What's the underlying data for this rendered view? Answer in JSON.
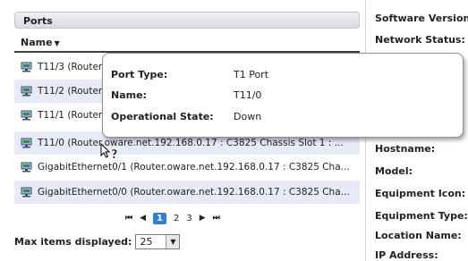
{
  "ports": {
    "header": "Ports",
    "column_name": "Name",
    "rows": [
      {
        "label": "T11/3 (Router.oware.net.192.168.0.17 : C3825 Chassis Slot 1 : ..."
      },
      {
        "label": "T11/2 (Router.oware.net.192.168.0.17 : C3825 Chassis Slot 1 : ..."
      },
      {
        "label": "T11/1 (Router.oware.net.192.168.0.17 : C3825 Chassis Slot 1 : ..."
      },
      {
        "label": "T11/0 (Router.oware.net.192.168.0.17 : C3825 Chassis Slot 1 : ..."
      },
      {
        "label": "GigabitEthernet0/1 (Router.oware.net.192.168.0.17 : C3825 Cha..."
      },
      {
        "label": "GigabitEthernet0/0 (Router.oware.net.192.168.0.17 : C3825 Cha..."
      }
    ],
    "pagination": {
      "first": "⏮",
      "prev": "◀",
      "pages": [
        "1",
        "2",
        "3"
      ],
      "current_page": "1",
      "next": "▶",
      "last": "⏭"
    },
    "max_items_label": "Max items displayed:",
    "max_items_value": "25"
  },
  "details": {
    "labels": [
      "Software Version",
      "Network Status:",
      "Hostname:",
      "Model:",
      "Equipment Icon:",
      "Equipment Type:",
      "Location Name:",
      "IP Address:"
    ]
  },
  "tooltip": {
    "rows": [
      {
        "label": "Port Type:",
        "value": "T1 Port"
      },
      {
        "label": "Name:",
        "value": "T11/0"
      },
      {
        "label": "Operational State:",
        "value": "Down"
      }
    ]
  },
  "colors": {
    "current_page": "#2e7fd6",
    "alt_row": "#e8eaf8"
  }
}
